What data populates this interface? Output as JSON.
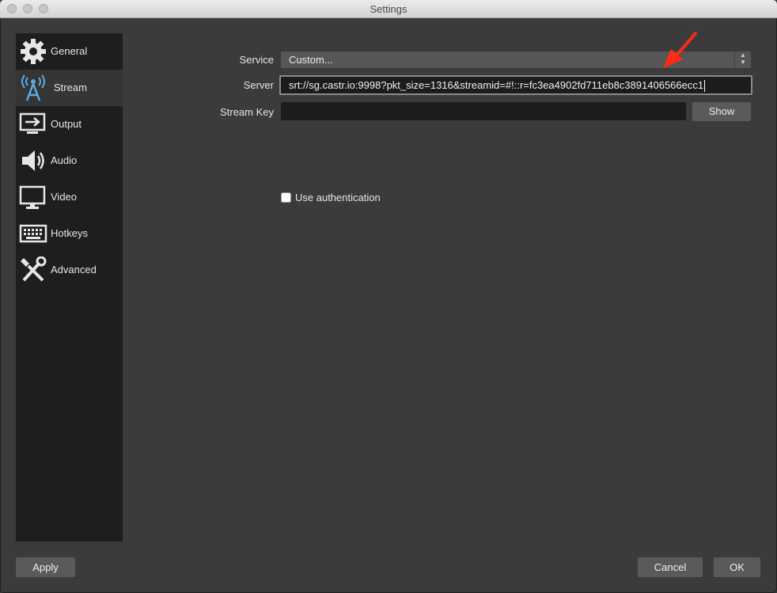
{
  "window": {
    "title": "Settings"
  },
  "sidebar": {
    "items": [
      {
        "label": "General",
        "icon": "gear-icon"
      },
      {
        "label": "Stream",
        "icon": "broadcast-antenna-icon",
        "selected": true
      },
      {
        "label": "Output",
        "icon": "output-monitor-icon"
      },
      {
        "label": "Audio",
        "icon": "speaker-icon"
      },
      {
        "label": "Video",
        "icon": "monitor-icon"
      },
      {
        "label": "Hotkeys",
        "icon": "keyboard-icon"
      },
      {
        "label": "Advanced",
        "icon": "wrench-screwdriver-icon"
      }
    ]
  },
  "stream": {
    "service_label": "Service",
    "service_value": "Custom...",
    "server_label": "Server",
    "server_value": "srt://sg.castr.io:9998?pkt_size=1316&streamid=#!::r=fc3ea4902fd711eb8c3891406566ecc1",
    "stream_key_label": "Stream Key",
    "stream_key_value": "",
    "show_label": "Show",
    "use_auth_label": "Use authentication",
    "use_auth_checked": false
  },
  "footer": {
    "apply_label": "Apply",
    "cancel_label": "Cancel",
    "ok_label": "OK"
  },
  "colors": {
    "annotation_arrow": "#ff2a12",
    "sidebar_bg": "#1e1e1e",
    "window_bg": "#3b3b3b"
  }
}
